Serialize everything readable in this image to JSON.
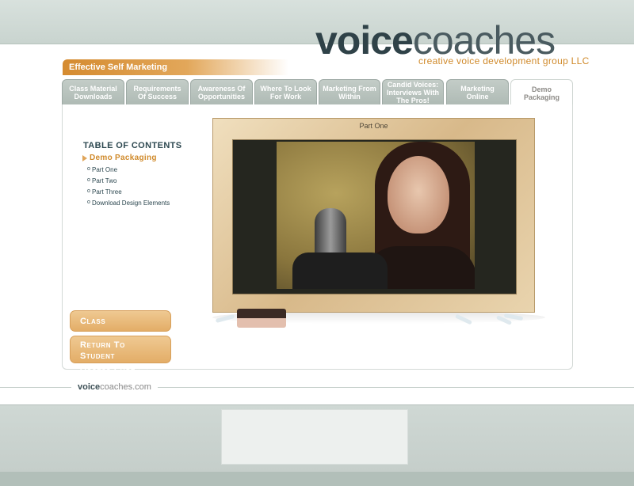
{
  "brand": {
    "logo_bold": "voice",
    "logo_light": "coaches",
    "tagline": "creative voice development group LLC"
  },
  "section_title": "Effective Self Marketing",
  "tabs": [
    {
      "label": "Class Material Downloads"
    },
    {
      "label": "Requirements Of Success"
    },
    {
      "label": "Awareness Of Opportunities"
    },
    {
      "label": "Where To Look For Work"
    },
    {
      "label": "Marketing From Within"
    },
    {
      "label": "Candid Voices: Interviews With The Pros!"
    },
    {
      "label": "Marketing Online"
    },
    {
      "label": "Demo Packaging"
    }
  ],
  "active_tab": "Demo Packaging",
  "toc": {
    "title": "TABLE OF CONTENTS",
    "current": "Demo Packaging",
    "items": [
      "Part One",
      "Part Two",
      "Part Three",
      "Download Design Elements"
    ]
  },
  "buttons": {
    "class_instructions": "Class Instructions",
    "return_line1": "Return To Student",
    "return_line2": "Access Page > >"
  },
  "video": {
    "label": "Part One"
  },
  "footer": {
    "logo_bold": "voice",
    "logo_light": "coaches.com"
  },
  "colors": {
    "accent": "#d08a2b",
    "tab_bg": "#aebab4",
    "text_dark": "#2d4850"
  }
}
